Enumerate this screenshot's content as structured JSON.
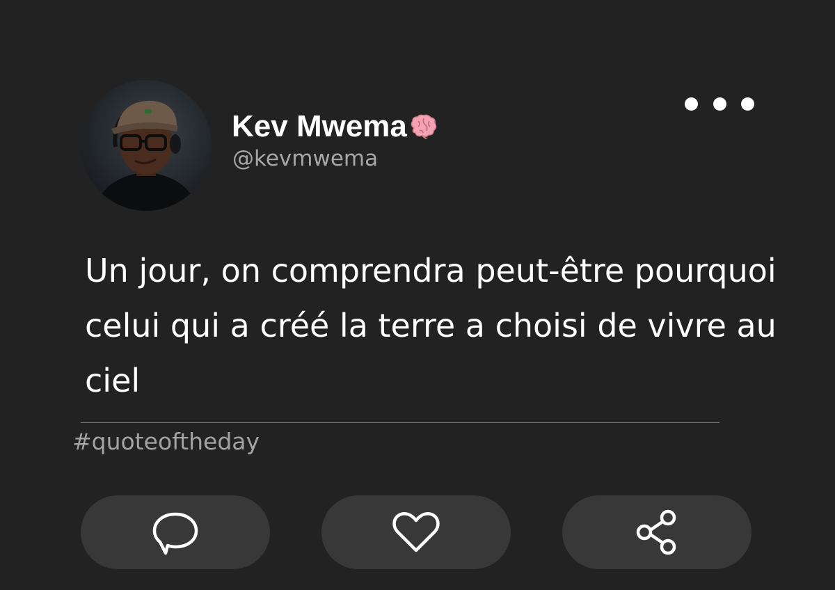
{
  "author": {
    "name": "Kev Mwema",
    "name_emoji_icon": "brain-icon",
    "handle": "@kevmwema",
    "avatar": "profile-photo"
  },
  "post": {
    "text": "Un jour, on comprendra peut-être pourquoi celui qui a créé la terre a choisi de vivre au ciel",
    "hashtag": "#quoteoftheday"
  },
  "menu": {
    "icon": "more-options-icon"
  },
  "actions": [
    {
      "name": "comment",
      "icon": "comment-icon"
    },
    {
      "name": "like",
      "icon": "heart-icon"
    },
    {
      "name": "share",
      "icon": "share-icon"
    }
  ],
  "colors": {
    "background": "#222222",
    "button_background": "#383838",
    "text_primary": "#ffffff",
    "text_secondary": "#a7a7a7",
    "brain_pink": "#f4a3b5"
  }
}
